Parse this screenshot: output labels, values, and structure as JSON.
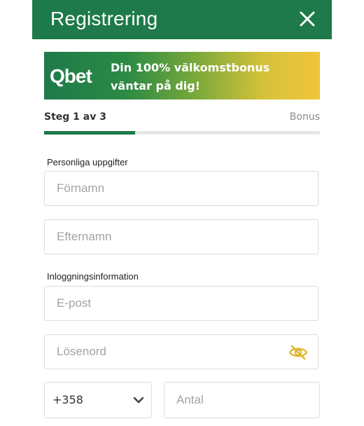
{
  "header": {
    "title": "Registrering",
    "close_icon": "close-icon",
    "background": "#1e7a4a"
  },
  "banner": {
    "logo_text": "Qbet",
    "text": "Din 100% välkomstbonus väntar på dig!"
  },
  "progress": {
    "step_label": "Steg 1 av 3",
    "bonus_label": "Bonus",
    "fraction": 0.33,
    "accent": "#1e7a4a"
  },
  "sections": {
    "personal": "Personliga uppgifter",
    "login": "Inloggningsinformation"
  },
  "fields": {
    "first_name_placeholder": "Förnamn",
    "last_name_placeholder": "Efternamn",
    "email_placeholder": "E-post",
    "password_placeholder": "Lösenord",
    "password_toggle_icon": "eye-slash-icon",
    "country_code": "+358",
    "country_chevron_icon": "chevron-down-icon",
    "phone_placeholder": "Antal"
  }
}
